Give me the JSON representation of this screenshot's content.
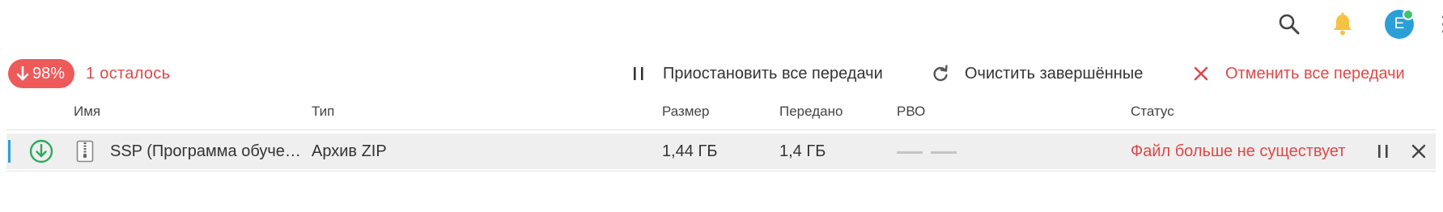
{
  "header": {
    "avatar_letter": "E",
    "icons": [
      "search-icon",
      "bell-icon",
      "avatar",
      "kebab-menu-icon"
    ]
  },
  "summary": {
    "progress_label": "98%",
    "remaining_label": "1 осталось"
  },
  "actions": {
    "pause_all": "Приостановить все передачи",
    "clear_completed": "Очистить завершённые",
    "cancel_all": "Отменить все передачи"
  },
  "table": {
    "columns": [
      "Имя",
      "Тип",
      "Размер",
      "Передано",
      "РВО",
      "Статус"
    ],
    "rows": [
      {
        "name": "SSP (Программа обуче…",
        "type": "Архив ZIP",
        "size": "1,44 ГБ",
        "transferred": "1,4 ГБ",
        "eta": "",
        "status": "Файл больше не существует"
      }
    ]
  },
  "colors": {
    "accent_red": "#e04848",
    "badge_red": "#ee5a5a",
    "blue": "#2b9fd8",
    "green": "#2eaa5c",
    "bell_yellow": "#f5c242"
  }
}
